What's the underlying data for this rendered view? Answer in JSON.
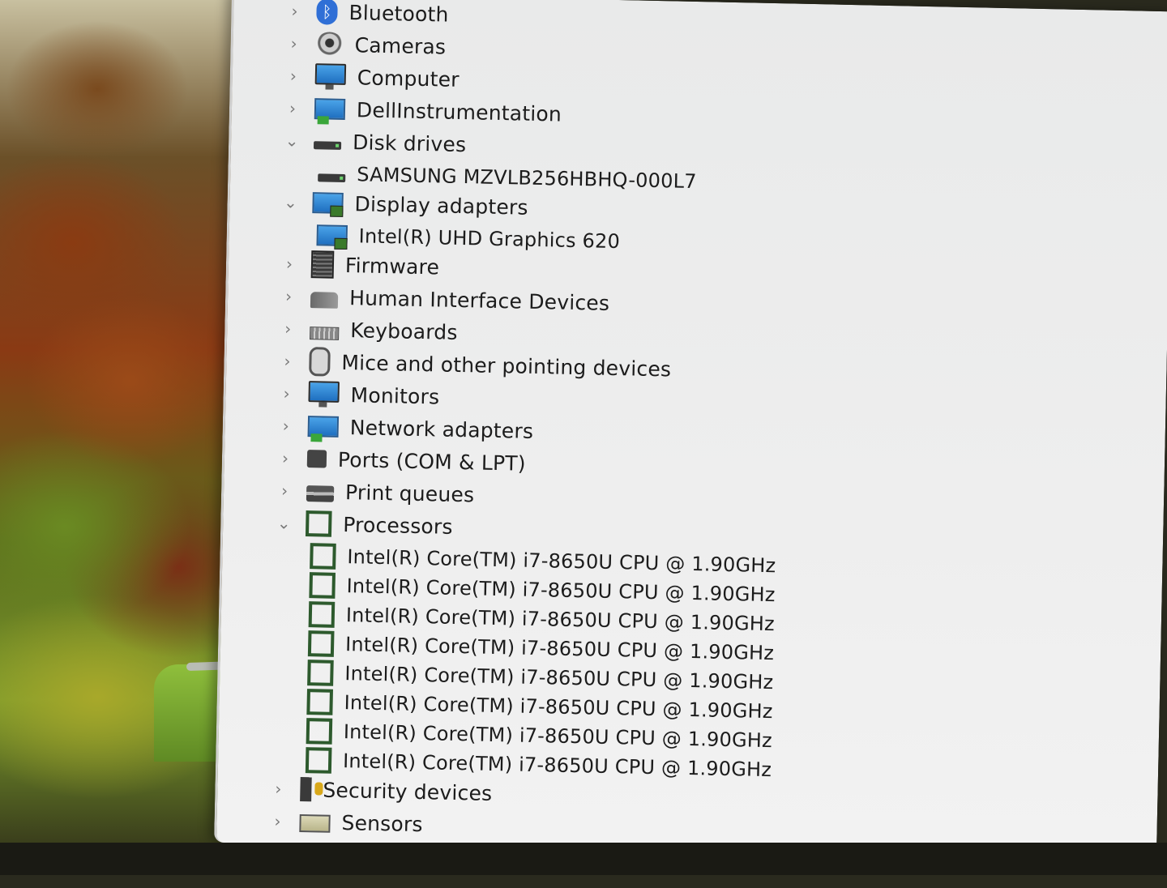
{
  "device_tree": [
    {
      "label": "Bluetooth",
      "icon": "bluetooth-icon",
      "expanded": false
    },
    {
      "label": "Cameras",
      "icon": "camera-icon",
      "expanded": false
    },
    {
      "label": "Computer",
      "icon": "monitor-icon",
      "expanded": false
    },
    {
      "label": "DellInstrumentation",
      "icon": "network-monitor-icon",
      "expanded": false
    },
    {
      "label": "Disk drives",
      "icon": "disk-drive-icon",
      "expanded": true,
      "children": [
        "SAMSUNG MZVLB256HBHQ-000L7"
      ]
    },
    {
      "label": "Display adapters",
      "icon": "display-adapter-icon",
      "expanded": true,
      "children": [
        "Intel(R) UHD Graphics 620"
      ]
    },
    {
      "label": "Firmware",
      "icon": "firmware-chip-icon",
      "expanded": false
    },
    {
      "label": "Human Interface Devices",
      "icon": "hid-icon",
      "expanded": false
    },
    {
      "label": "Keyboards",
      "icon": "keyboard-icon",
      "expanded": false
    },
    {
      "label": "Mice and other pointing devices",
      "icon": "mouse-icon",
      "expanded": false
    },
    {
      "label": "Monitors",
      "icon": "monitor-icon",
      "expanded": false
    },
    {
      "label": "Network adapters",
      "icon": "network-adapter-icon",
      "expanded": false
    },
    {
      "label": "Ports (COM & LPT)",
      "icon": "port-icon",
      "expanded": false
    },
    {
      "label": "Print queues",
      "icon": "printer-icon",
      "expanded": false
    },
    {
      "label": "Processors",
      "icon": "processor-icon",
      "expanded": true,
      "children": [
        "Intel(R) Core(TM) i7-8650U CPU @ 1.90GHz",
        "Intel(R) Core(TM) i7-8650U CPU @ 1.90GHz",
        "Intel(R) Core(TM) i7-8650U CPU @ 1.90GHz",
        "Intel(R) Core(TM) i7-8650U CPU @ 1.90GHz",
        "Intel(R) Core(TM) i7-8650U CPU @ 1.90GHz",
        "Intel(R) Core(TM) i7-8650U CPU @ 1.90GHz",
        "Intel(R) Core(TM) i7-8650U CPU @ 1.90GHz",
        "Intel(R) Core(TM) i7-8650U CPU @ 1.90GHz"
      ]
    },
    {
      "label": "Security devices",
      "icon": "security-key-icon",
      "expanded": false
    },
    {
      "label": "Sensors",
      "icon": "sensor-icon",
      "expanded": false
    }
  ],
  "glyphs": {
    "collapsed": "›",
    "expanded": "⌄"
  }
}
